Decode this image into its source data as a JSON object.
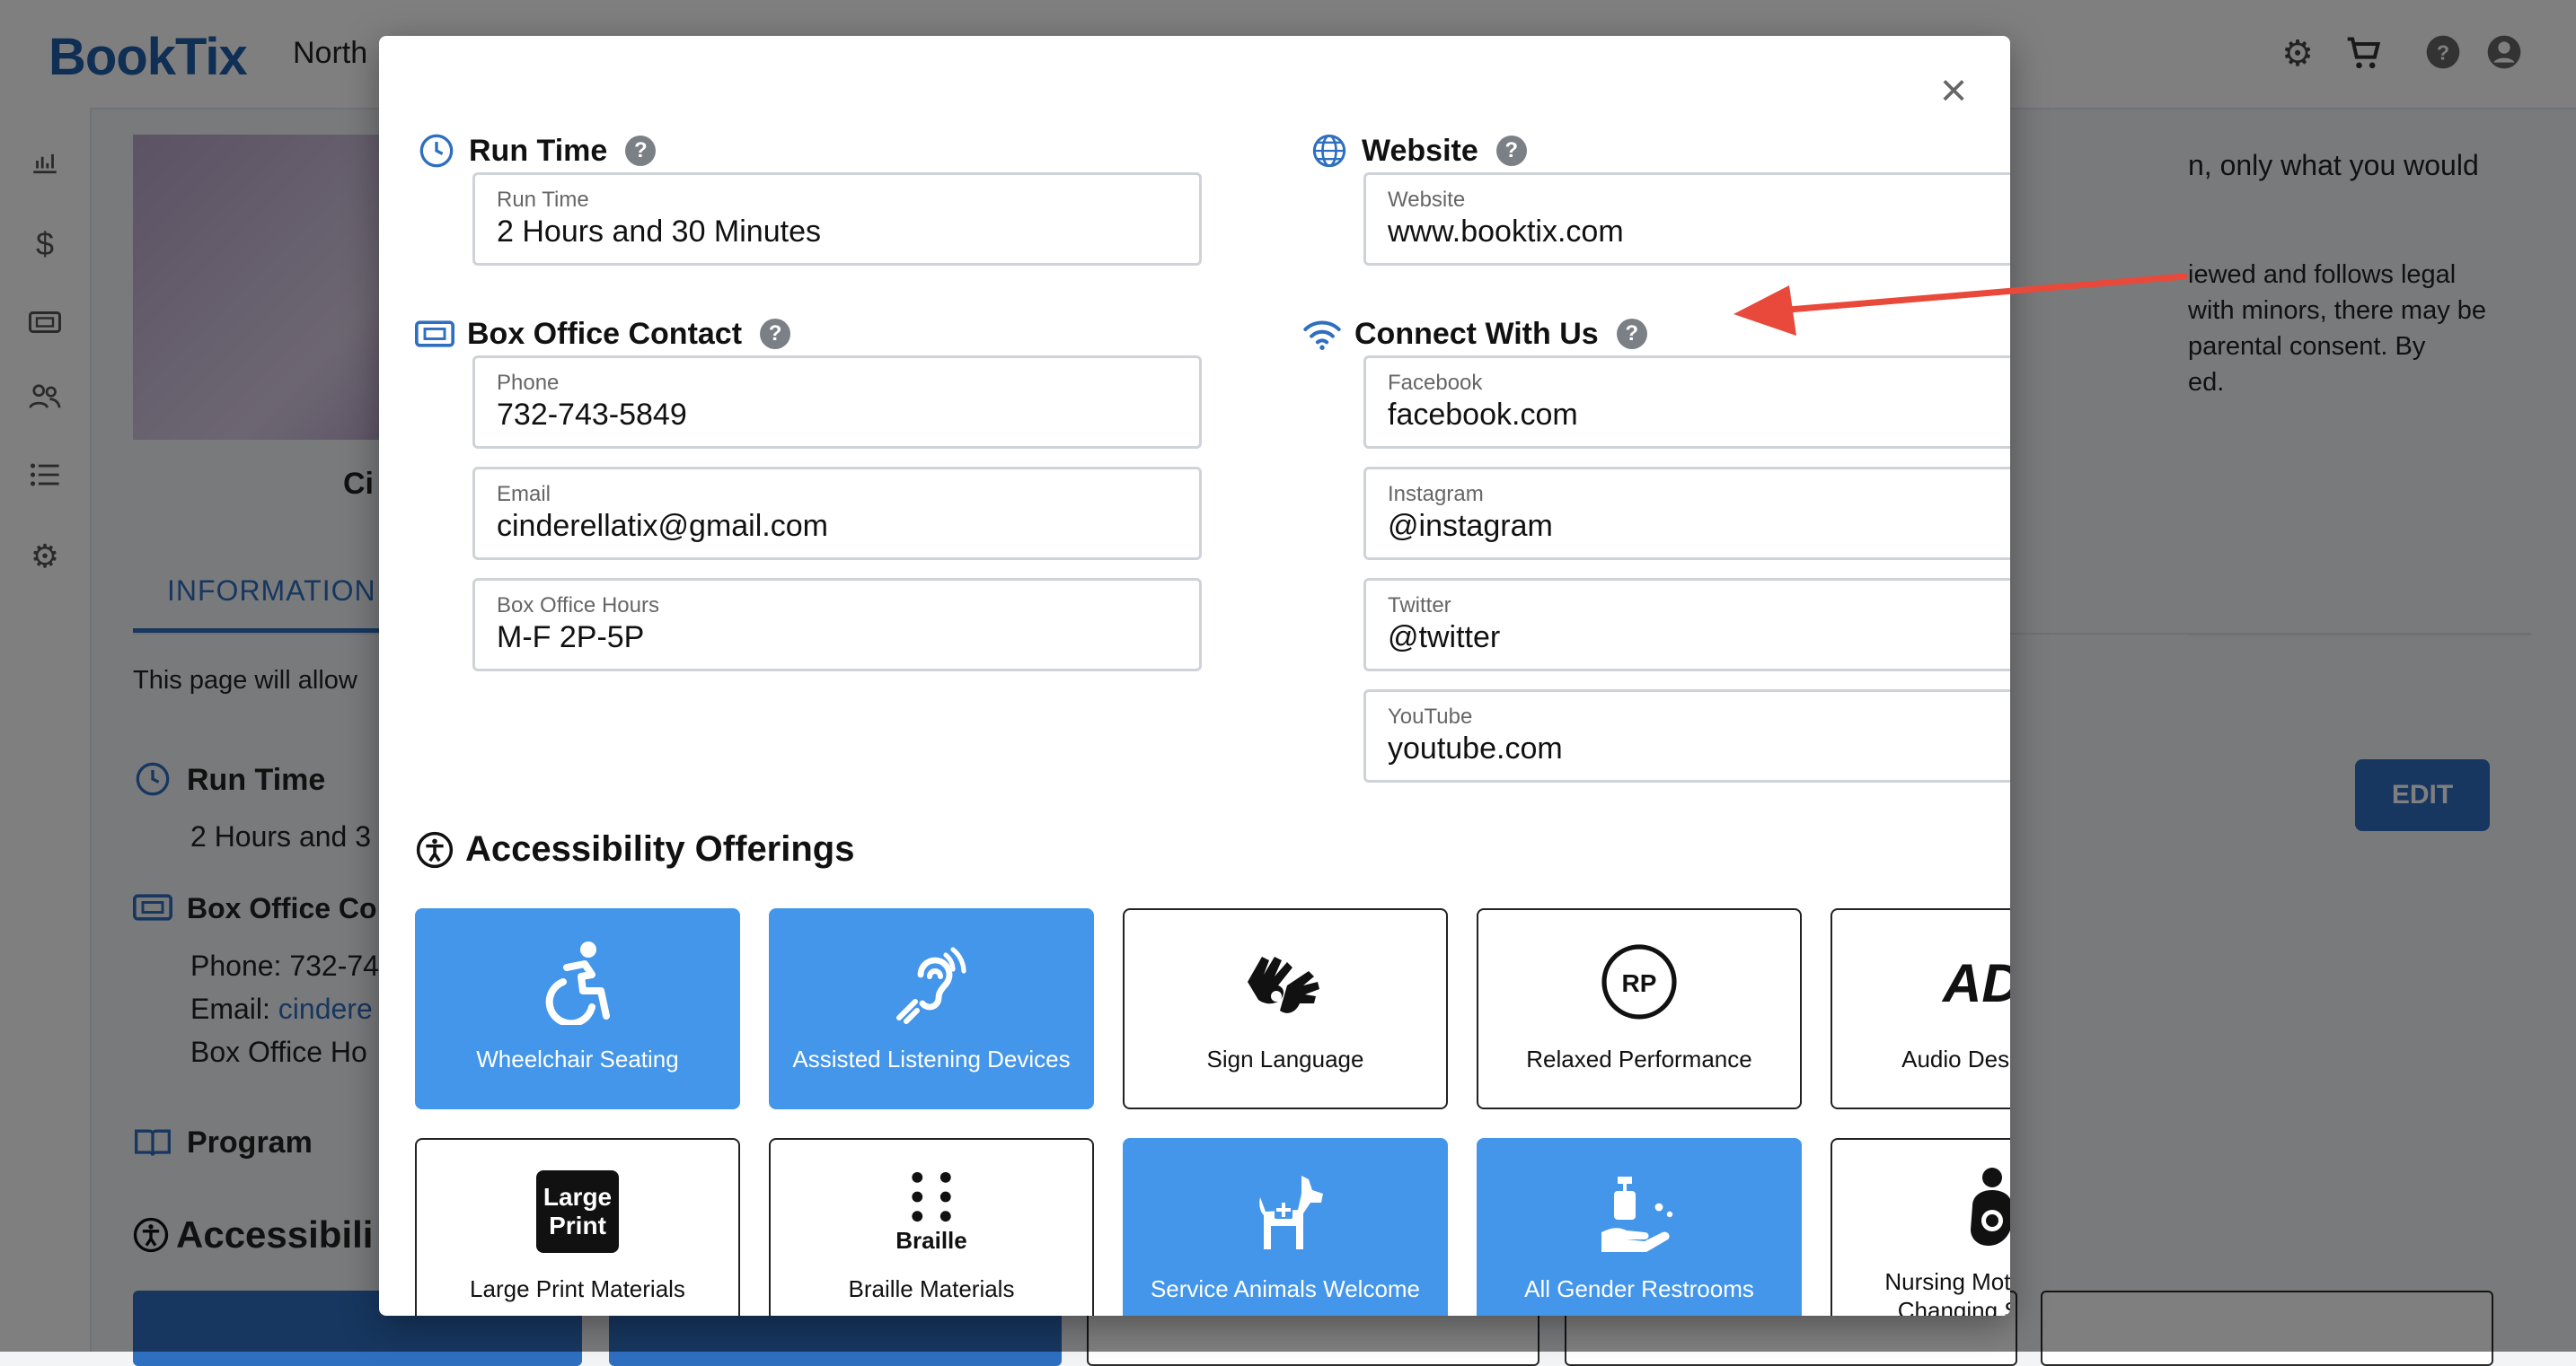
{
  "app": {
    "brand": "BookTix",
    "region": "North",
    "bg_tab": "INFORMATION",
    "bg_intro": "This page will allow",
    "bg_runtime_label": "Run Time",
    "bg_runtime_value": "2 Hours and 3",
    "bg_boxoffice_label": "Box Office Co",
    "bg_phone": "Phone: 732-74",
    "bg_email_prefix": "Email: ",
    "bg_email": "cindere",
    "bg_hours": "Box Office Ho",
    "bg_program": "Program",
    "bg_accessibility": "Accessibili",
    "bg_show_title": "Ci",
    "bg_right_text_1": "n, only what you would",
    "bg_right_text_2": "iewed and follows legal",
    "bg_right_text_3": "with minors, there may be",
    "bg_right_text_4": "parental consent. By",
    "bg_right_text_5": "ed.",
    "edit_label": "EDIT"
  },
  "modal": {
    "close_symbol": "×",
    "run_time": {
      "heading": "Run Time",
      "label": "Run Time",
      "value": "2 Hours and 30 Minutes"
    },
    "website": {
      "heading": "Website",
      "label": "Website",
      "value": "www.booktix.com"
    },
    "box_office": {
      "heading": "Box Office Contact",
      "phone_label": "Phone",
      "phone_value": "732-743-5849",
      "email_label": "Email",
      "email_value": "cinderellatix@gmail.com",
      "hours_label": "Box Office Hours",
      "hours_value": "M-F 2P-5P"
    },
    "connect": {
      "heading": "Connect With Us",
      "facebook_label": "Facebook",
      "facebook_value": "facebook.com",
      "instagram_label": "Instagram",
      "instagram_value": "@instagram",
      "twitter_label": "Twitter",
      "twitter_value": "@twitter",
      "youtube_label": "YouTube",
      "youtube_value": "youtube.com"
    },
    "accessibility": {
      "heading": "Accessibility Offerings",
      "items": [
        {
          "label": "Wheelchair Seating",
          "active": true,
          "icon": "wheelchair-icon"
        },
        {
          "label": "Assisted Listening Devices",
          "active": true,
          "icon": "hearing-icon"
        },
        {
          "label": "Sign Language",
          "active": false,
          "icon": "sign-language-icon"
        },
        {
          "label": "Relaxed Performance",
          "active": false,
          "icon": "rp-icon",
          "icon_text": "RP"
        },
        {
          "label": "Audio Description",
          "active": false,
          "icon": "audio-description-icon",
          "icon_text": "AD"
        },
        {
          "label": "Large Print Materials",
          "active": false,
          "icon": "large-print-icon",
          "icon_text": "Large Print"
        },
        {
          "label": "Braille Materials",
          "active": false,
          "icon": "braille-icon",
          "icon_text": "Braille"
        },
        {
          "label": "Service Animals Welcome",
          "active": true,
          "icon": "service-dog-icon"
        },
        {
          "label": "All Gender Restrooms",
          "active": true,
          "icon": "restroom-icon"
        },
        {
          "label": "Nursing Mothers and Changing Stations",
          "active": false,
          "icon": "nursing-icon"
        }
      ]
    }
  },
  "colors": {
    "brand": "#1f5ea8",
    "accent": "#4396ea",
    "annotation_arrow": "#e8493a"
  }
}
